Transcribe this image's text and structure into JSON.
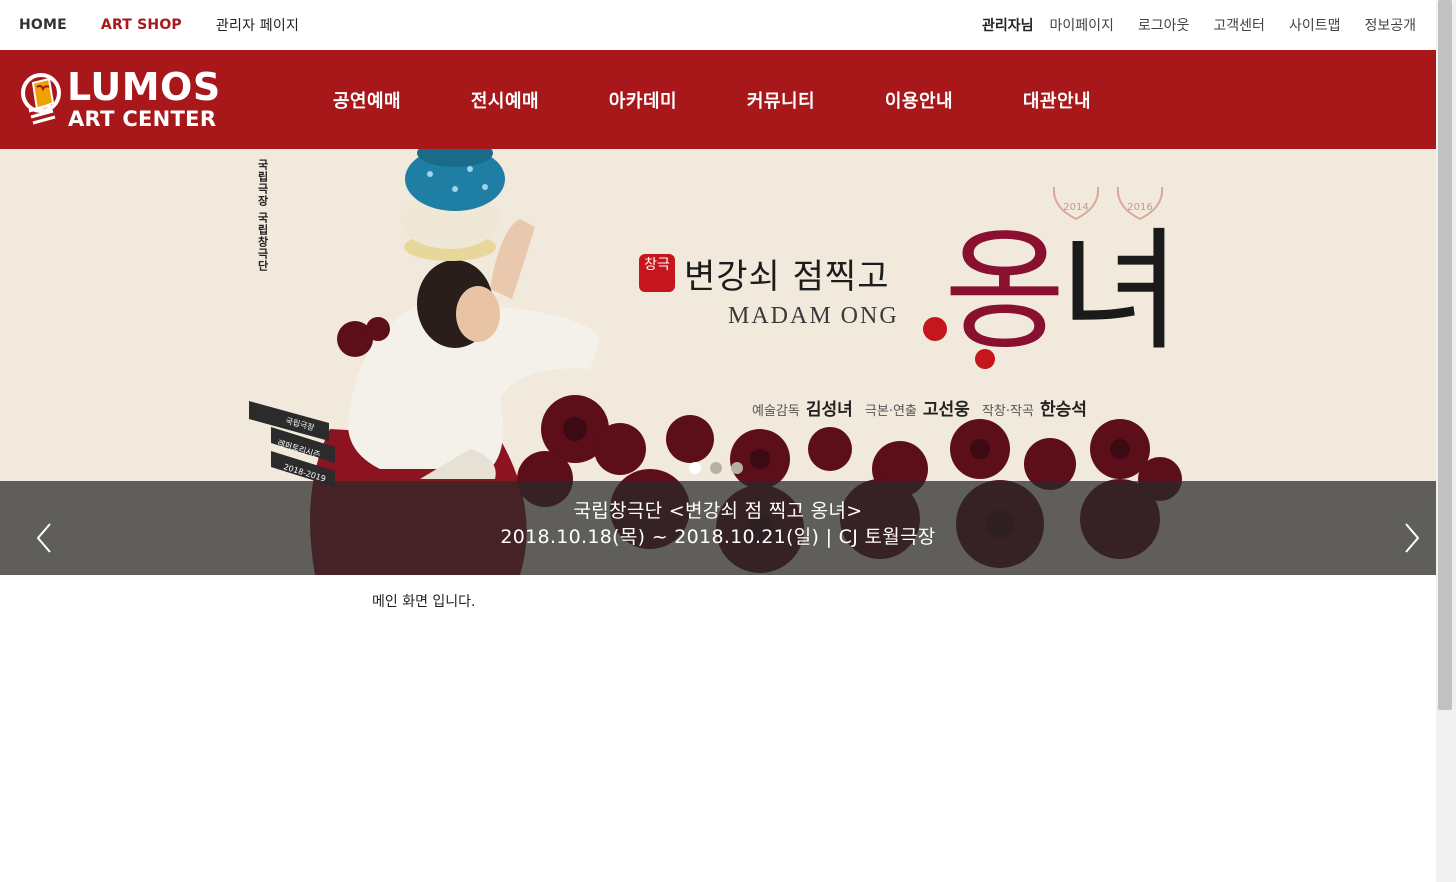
{
  "topbar": {
    "home": "HOME",
    "art_shop": "ART SHOP",
    "admin_page": "관리자 페이지",
    "user": "관리자님",
    "links": [
      "마이페이지",
      "로그아웃",
      "고객센터",
      "사이트맵",
      "정보공개"
    ]
  },
  "logo": {
    "line1": "LUMOS",
    "line2": "ART CENTER"
  },
  "nav": [
    "공연예매",
    "전시예매",
    "아카데미",
    "커뮤니티",
    "이용안내",
    "대관안내"
  ],
  "banner": {
    "vertical_text": "국립극장 국립창극단",
    "laurels": [
      "2014",
      "2016"
    ],
    "seal": "창극",
    "title_ko": "변강쇠 점찍고",
    "title_en": "MADAM ONG",
    "title_big_1": "옹",
    "title_big_2": "녀",
    "credits": {
      "role1": "예술감독",
      "name1": "김성녀",
      "role2": "극본·연출",
      "name2": "고선웅",
      "role3": "작창·작곡",
      "name3": "한승석"
    },
    "rep_box": [
      "국립극장",
      "레퍼토리시즌",
      "2018-2019"
    ],
    "slides": {
      "count": 3,
      "active": 1
    },
    "caption_line1": "국립창극단 <변강쇠 점 찍고 옹녀>",
    "caption_line2": "2018.10.18(목) ~ 2018.10.21(일)  | CJ 토월극장"
  },
  "main": {
    "message": "메인 화면 입니다."
  },
  "colors": {
    "brand_red": "#a8171a",
    "banner_bg": "#f1e9dc"
  }
}
